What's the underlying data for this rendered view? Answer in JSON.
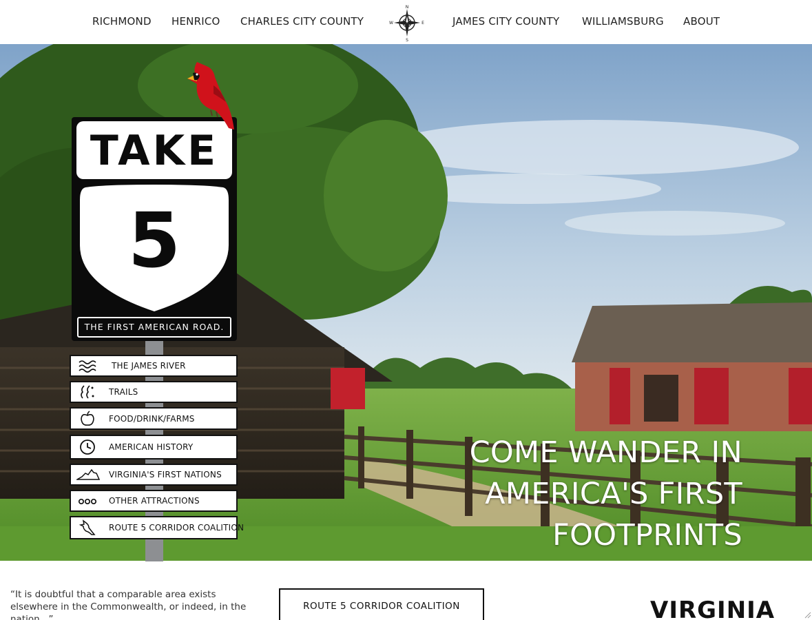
{
  "nav": {
    "left": [
      "RICHMOND",
      "HENRICO",
      "CHARLES CITY COUNTY"
    ],
    "right": [
      "JAMES CITY COUNTY",
      "WILLIAMSBURG",
      "ABOUT"
    ],
    "compass": {
      "icon": "compass-rose-icon",
      "n": "N",
      "s": "S",
      "e": "E",
      "w": "W"
    }
  },
  "sign": {
    "take": "TAKE",
    "number": "5",
    "tagline": "THE FIRST AMERICAN ROAD."
  },
  "menu": [
    {
      "label": "THE JAMES RIVER",
      "icon": "waves-icon"
    },
    {
      "label": "TRAILS",
      "icon": "footprints-icon"
    },
    {
      "label": "FOOD/DRINK/FARMS",
      "icon": "apple-icon"
    },
    {
      "label": "AMERICAN HISTORY",
      "icon": "clock-icon"
    },
    {
      "label": "VIRGINIA'S FIRST NATIONS",
      "icon": "virginia-map-icon"
    },
    {
      "label": "OTHER ATTRACTIONS",
      "icon": "dots-icon"
    },
    {
      "label": "ROUTE 5 CORRIDOR COALITION",
      "icon": "cardinal-outline-icon"
    }
  ],
  "headline": [
    "COME WANDER IN",
    "AMERICA'S FIRST",
    "FOOTPRINTS"
  ],
  "quote": "“It is doubtful that a comparable area exists elsewhere in the Commonwealth, or indeed, in the nation...”",
  "coalition_button": "ROUTE 5 CORRIDOR COALITION",
  "logo_text": "VIRGINIA",
  "colors": {
    "cardinal": "#d0121b",
    "sign": "#0b0b0b",
    "sky": "#b9cfe2",
    "grass": "#6fa23a"
  }
}
